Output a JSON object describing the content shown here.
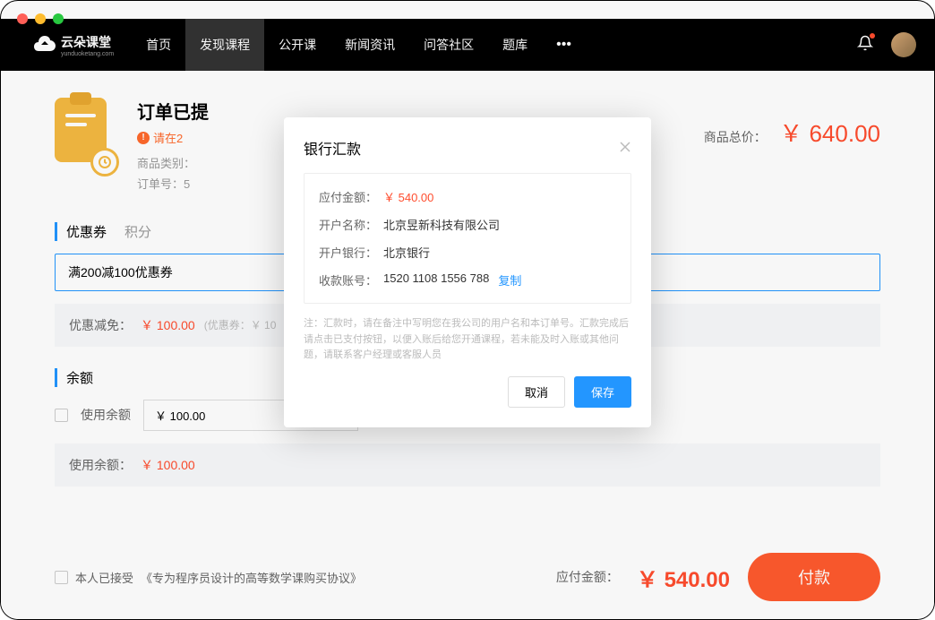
{
  "logo": {
    "text": "云朵课堂",
    "sub": "yunduoketang.com"
  },
  "nav": {
    "items": [
      "首页",
      "发现课程",
      "公开课",
      "新闻资讯",
      "问答社区",
      "题库"
    ],
    "activeIndex": 1
  },
  "order": {
    "title": "订单已提",
    "warn": "请在2",
    "meta1": "商品类别：",
    "meta2": "订单号：5",
    "totalLabel": "商品总价：",
    "totalValue": "￥ 640.00"
  },
  "coupon": {
    "title": "优惠券",
    "tab": "积分",
    "selected": "满200减100优惠券",
    "discountLabel": "优惠减免：",
    "discountValue": "￥ 100.00",
    "hint": "(优惠券：￥ 10"
  },
  "balance": {
    "title": "余额",
    "useLabel": "使用余额",
    "inputValue": "￥ 100.00",
    "usedLabel": "使用余额：",
    "usedValue": "￥ 100.00"
  },
  "footer": {
    "agreePrefix": "本人已接受",
    "agreeLink": "《专为程序员设计的高等数学课购买协议》",
    "payLabel": "应付金额：",
    "payAmount": "￥ 540.00",
    "payBtn": "付款"
  },
  "modal": {
    "title": "银行汇款",
    "rows": [
      {
        "label": "应付金额：",
        "value": "￥ 540.00",
        "red": true
      },
      {
        "label": "开户名称：",
        "value": "北京昱新科技有限公司"
      },
      {
        "label": "开户银行：",
        "value": "北京银行"
      },
      {
        "label": "收款账号：",
        "value": "1520 1108 1556 788",
        "copy": true
      }
    ],
    "copyText": "复制",
    "note": "注：汇款时，请在备注中写明您在我公司的用户名和本订单号。汇款完成后请点击已支付按钮，以便入账后给您开通课程，若未能及时入账或其他问题，请联系客户经理或客服人员",
    "cancel": "取消",
    "save": "保存"
  }
}
